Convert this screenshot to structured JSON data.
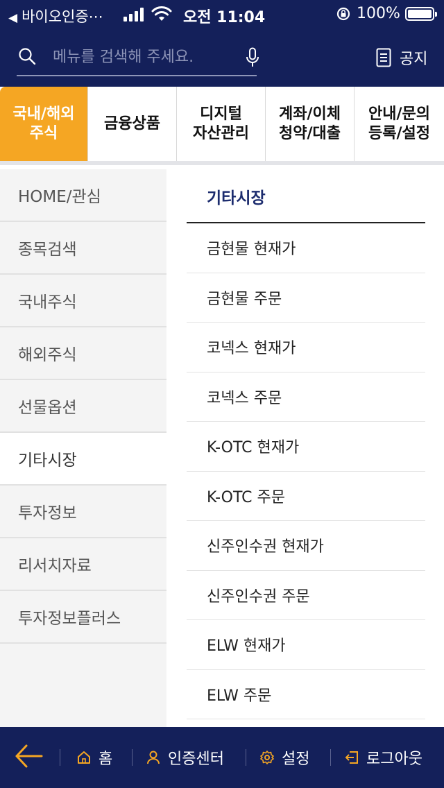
{
  "status_bar": {
    "back_app": "바이오인증⋯",
    "time": "오전 11:04",
    "battery": "100%"
  },
  "header": {
    "search_placeholder": "메뉴를 검색해 주세요.",
    "notice_label": "공지"
  },
  "tabs": [
    {
      "label": "국내/해외\n주식",
      "active": true
    },
    {
      "label": "금융상품",
      "active": false
    },
    {
      "label": "디지털\n자산관리",
      "active": false
    },
    {
      "label": "계좌/이체\n청약/대출",
      "active": false
    },
    {
      "label": "안내/문의\n등록/설정",
      "active": false
    }
  ],
  "sidebar": {
    "items": [
      {
        "label": "HOME/관심"
      },
      {
        "label": "종목검색"
      },
      {
        "label": "국내주식"
      },
      {
        "label": "해외주식"
      },
      {
        "label": "선물옵션"
      },
      {
        "label": "기타시장"
      },
      {
        "label": "투자정보"
      },
      {
        "label": "리서치자료"
      },
      {
        "label": "투자정보플러스"
      }
    ],
    "active_label": "기타시장"
  },
  "main": {
    "section_title": "기타시장",
    "items": [
      {
        "label": "금현물 현재가"
      },
      {
        "label": "금현물 주문"
      },
      {
        "label": "코넥스 현재가"
      },
      {
        "label": "코넥스 주문"
      },
      {
        "label": "K-OTC 현재가"
      },
      {
        "label": "K-OTC 주문"
      },
      {
        "label": "신주인수권 현재가"
      },
      {
        "label": "신주인수권 주문"
      },
      {
        "label": "ELW 현재가"
      },
      {
        "label": "ELW 주문"
      }
    ]
  },
  "bottom_bar": {
    "home": "홈",
    "auth_center": "인증센터",
    "settings": "설정",
    "logout": "로그아웃"
  },
  "colors": {
    "navy": "#14205a",
    "accent_orange": "#f5a623",
    "title_blue": "#1c2c6e"
  },
  "icons": [
    "search-icon",
    "mic-icon",
    "document-icon",
    "back-arrow-icon",
    "home-icon",
    "user-icon",
    "gear-icon",
    "logout-icon"
  ]
}
